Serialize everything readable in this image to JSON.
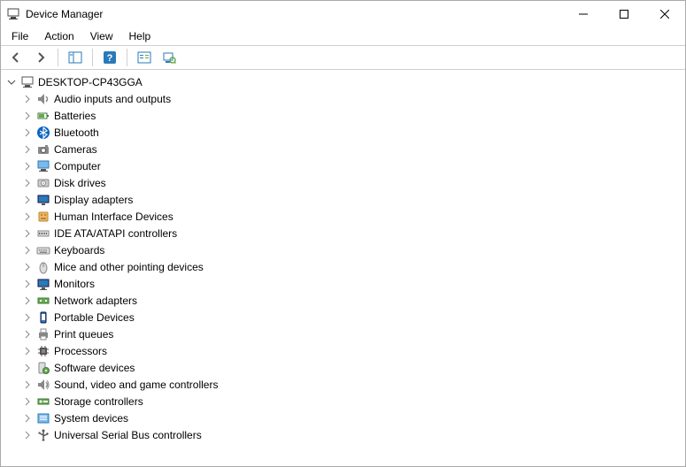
{
  "window": {
    "title": "Device Manager"
  },
  "menu": {
    "file": "File",
    "action": "Action",
    "view": "View",
    "help": "Help"
  },
  "toolbar": {
    "back": "back-icon",
    "forward": "forward-icon",
    "show_hide": "show-hide-console-tree-icon",
    "help": "help-icon",
    "properties": "properties-icon",
    "scan": "scan-hardware-icon"
  },
  "tree": {
    "root": {
      "label": "DESKTOP-CP43GGA",
      "expanded": true,
      "icon": "computer-icon"
    },
    "categories": [
      {
        "label": "Audio inputs and outputs",
        "icon": "audio-icon"
      },
      {
        "label": "Batteries",
        "icon": "battery-icon"
      },
      {
        "label": "Bluetooth",
        "icon": "bluetooth-icon"
      },
      {
        "label": "Cameras",
        "icon": "camera-icon"
      },
      {
        "label": "Computer",
        "icon": "computer-icon"
      },
      {
        "label": "Disk drives",
        "icon": "disk-icon"
      },
      {
        "label": "Display adapters",
        "icon": "display-icon"
      },
      {
        "label": "Human Interface Devices",
        "icon": "hid-icon"
      },
      {
        "label": "IDE ATA/ATAPI controllers",
        "icon": "ide-icon"
      },
      {
        "label": "Keyboards",
        "icon": "keyboard-icon"
      },
      {
        "label": "Mice and other pointing devices",
        "icon": "mouse-icon"
      },
      {
        "label": "Monitors",
        "icon": "monitor-icon"
      },
      {
        "label": "Network adapters",
        "icon": "network-icon"
      },
      {
        "label": "Portable Devices",
        "icon": "portable-icon"
      },
      {
        "label": "Print queues",
        "icon": "printer-icon"
      },
      {
        "label": "Processors",
        "icon": "processor-icon"
      },
      {
        "label": "Software devices",
        "icon": "software-icon"
      },
      {
        "label": "Sound, video and game controllers",
        "icon": "sound-icon"
      },
      {
        "label": "Storage controllers",
        "icon": "storage-icon"
      },
      {
        "label": "System devices",
        "icon": "system-icon"
      },
      {
        "label": "Universal Serial Bus controllers",
        "icon": "usb-icon"
      }
    ]
  }
}
